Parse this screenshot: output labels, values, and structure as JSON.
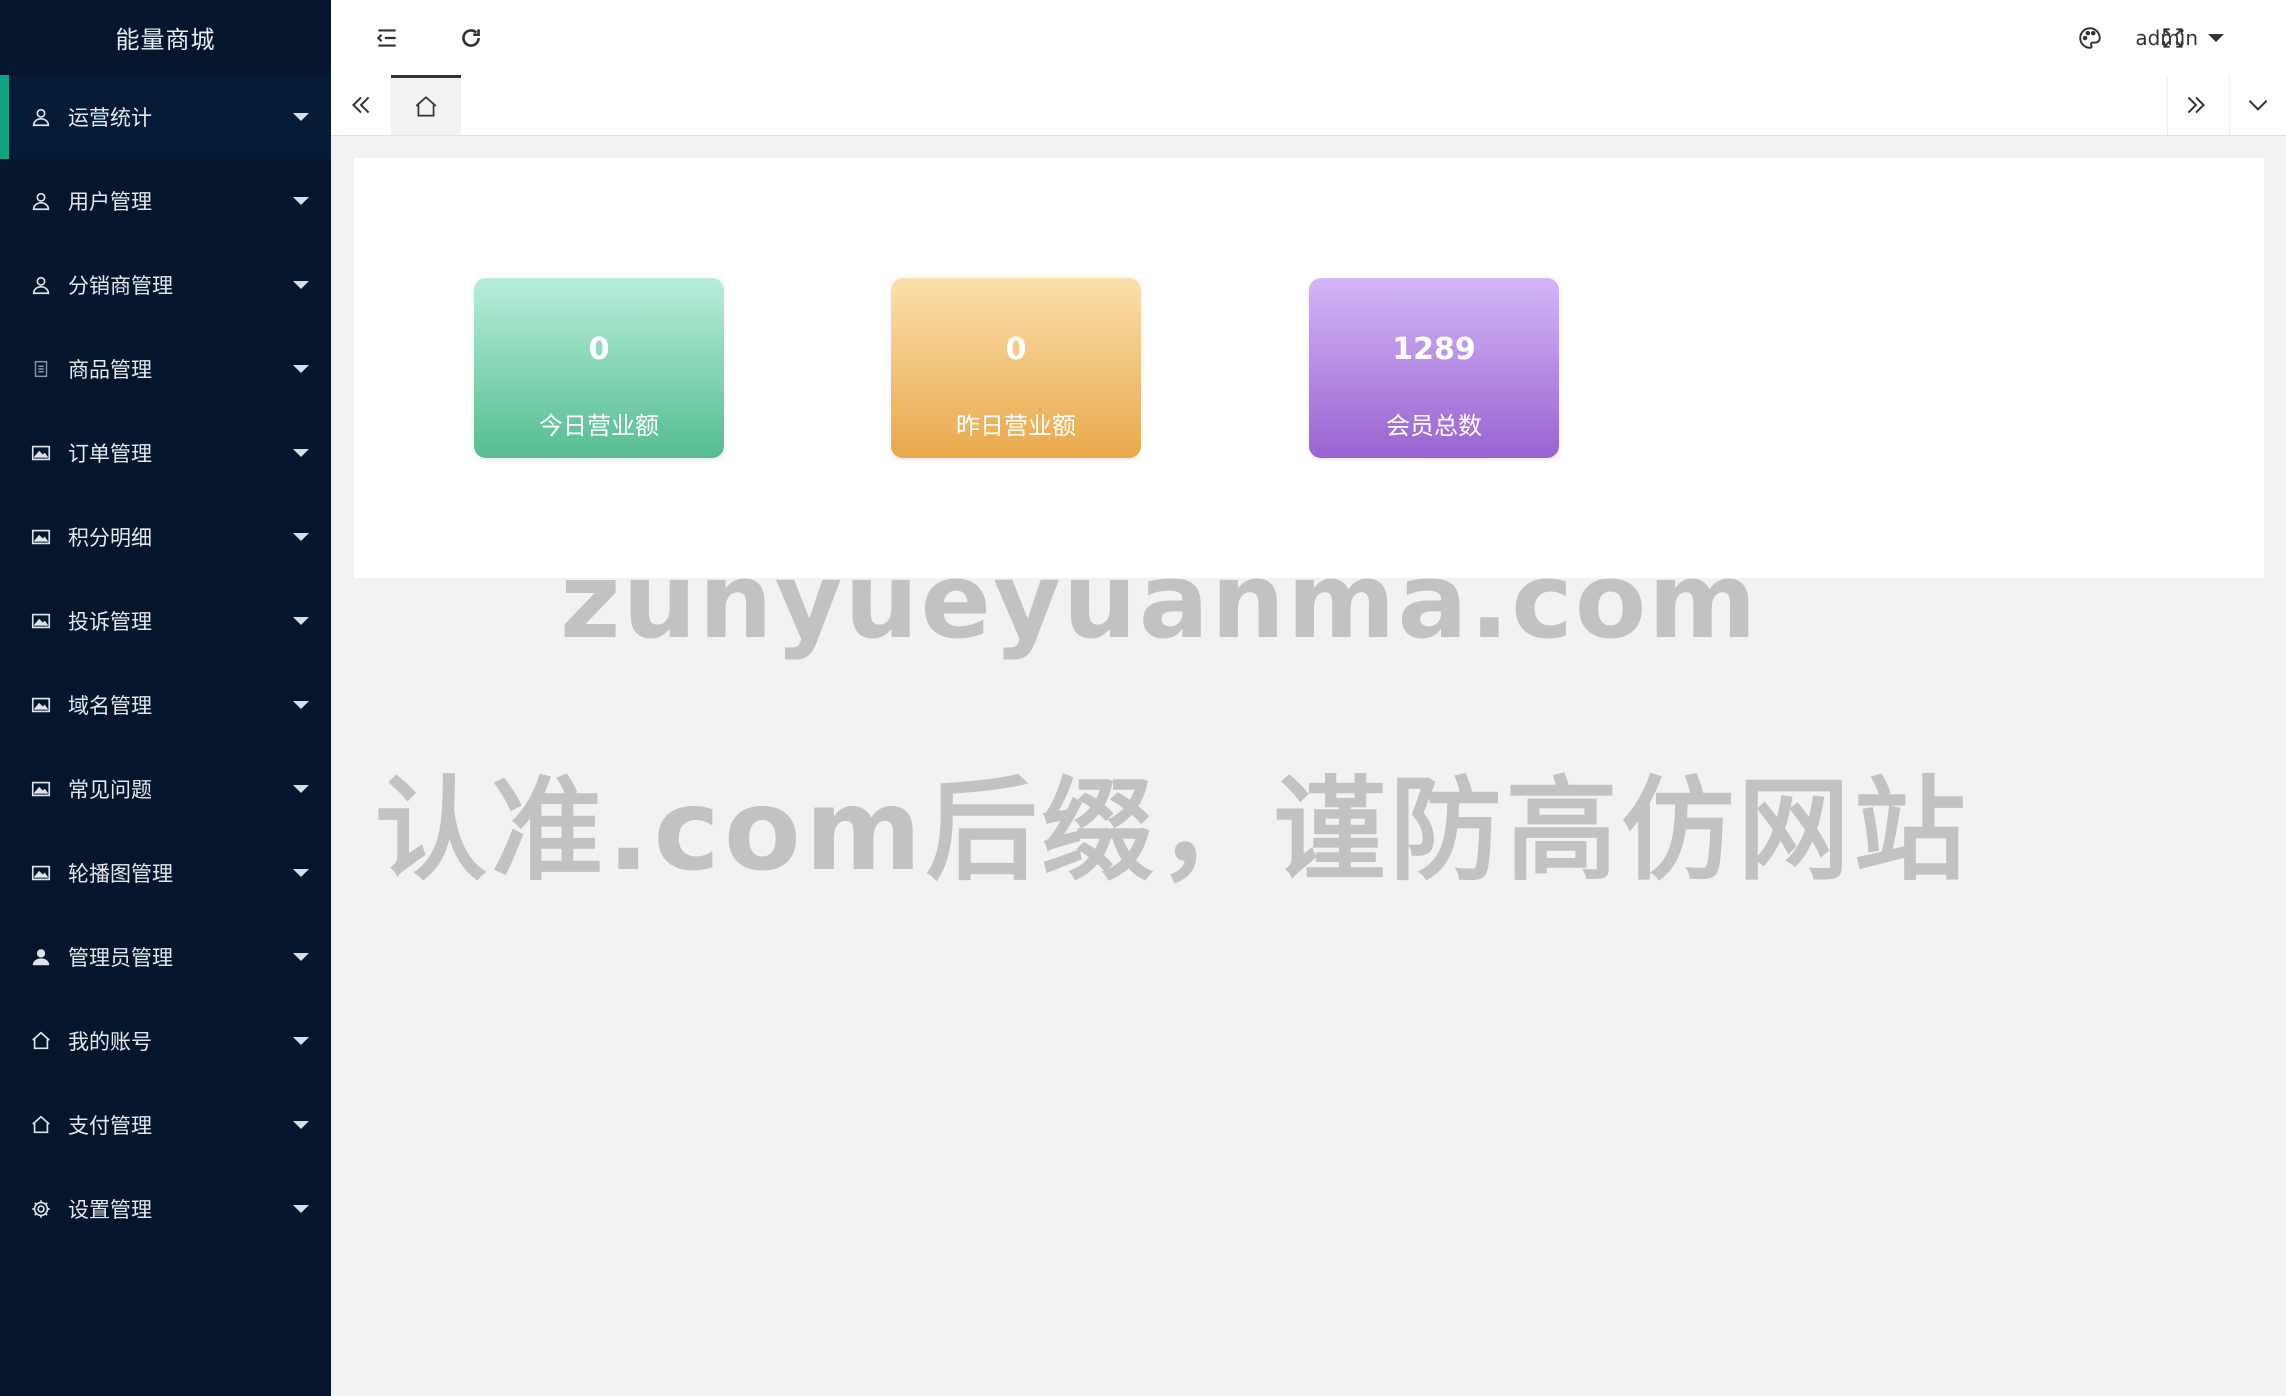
{
  "app": {
    "brand": "能量商城"
  },
  "sidebar": {
    "items": [
      {
        "label": "运营统计",
        "icon": "user-icon",
        "active": true
      },
      {
        "label": "用户管理",
        "icon": "user-icon"
      },
      {
        "label": "分销商管理",
        "icon": "user-icon"
      },
      {
        "label": "商品管理",
        "icon": "file-icon"
      },
      {
        "label": "订单管理",
        "icon": "image-icon"
      },
      {
        "label": "积分明细",
        "icon": "image-icon"
      },
      {
        "label": "投诉管理",
        "icon": "image-icon"
      },
      {
        "label": "域名管理",
        "icon": "image-icon"
      },
      {
        "label": "常见问题",
        "icon": "image-icon"
      },
      {
        "label": "轮播图管理",
        "icon": "image-icon"
      },
      {
        "label": "管理员管理",
        "icon": "person-icon"
      },
      {
        "label": "我的账号",
        "icon": "home-icon"
      },
      {
        "label": "支付管理",
        "icon": "home-icon"
      },
      {
        "label": "设置管理",
        "icon": "gear-icon"
      }
    ]
  },
  "header": {
    "user": "admin",
    "icons": [
      "menu-collapse-icon",
      "refresh-icon",
      "palette-icon",
      "fullscreen-icon"
    ]
  },
  "tabs": {
    "icons": [
      "double-chevron-left-icon",
      "home-icon",
      "double-chevron-right-icon",
      "chevron-down-icon"
    ]
  },
  "stats": [
    {
      "value": "0",
      "label": "今日营业额",
      "color": "#55bd90"
    },
    {
      "value": "0",
      "label": "昨日营业额",
      "color": "#e9a84b"
    },
    {
      "value": "1289",
      "label": "会员总数",
      "color": "#9a63d1"
    }
  ],
  "watermark": {
    "line1": "zunyueyuanma.com",
    "line2": "认准.com后缀，谨防高仿网站"
  }
}
